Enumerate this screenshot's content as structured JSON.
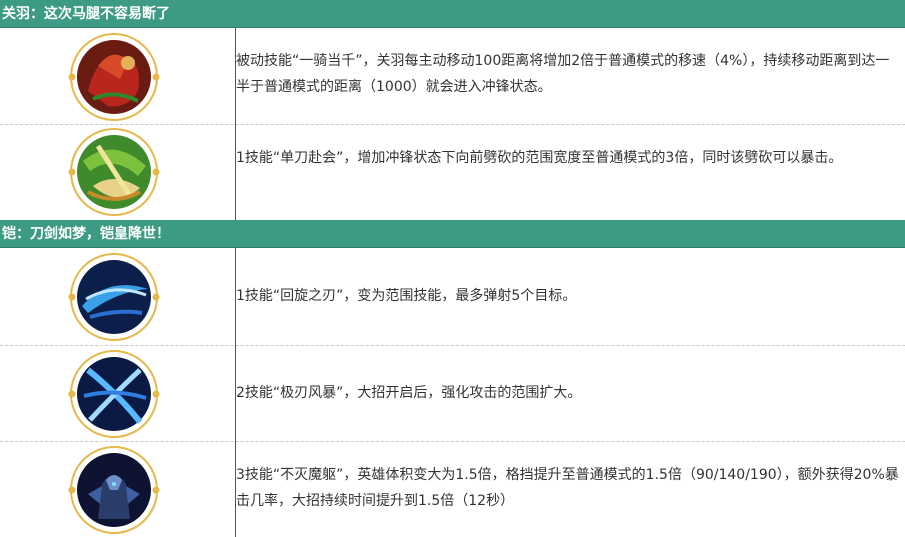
{
  "sections": [
    {
      "title": "关羽：这次马腿不容易断了",
      "rows": [
        {
          "icon": "guanyu-passive-skill-icon",
          "text": "被动技能“一骑当千”，关羽每主动移动100距离将增加2倍于普通模式的移速（4%），持续移动距离到达一半于普通模式的距离（1000）就会进入冲锋状态。"
        },
        {
          "icon": "guanyu-skill1-icon",
          "text": "1技能“单刀赴会”，增加冲锋状态下向前劈砍的范围宽度至普通模式的3倍，同时该劈砍可以暴击。"
        }
      ]
    },
    {
      "title": "铠：刀剑如梦，铠皇降世！",
      "rows": [
        {
          "icon": "kai-skill1-icon",
          "text": "1技能“回旋之刃”，变为范围技能，最多弹射5个目标。"
        },
        {
          "icon": "kai-skill2-icon",
          "text": "2技能“极刃风暴”，大招开启后，强化攻击的范围扩大。"
        },
        {
          "icon": "kai-skill3-icon",
          "text": "3技能“不灭魔躯”，英雄体积变大为1.5倍，格挡提升至普通模式的1.5倍（90/140/190），额外获得20%暴击几率，大招持续时间提升到1.5倍（12秒）"
        }
      ]
    }
  ],
  "colors": {
    "header_bg": "#3d9a84",
    "ring_gold": "#e6b84a"
  }
}
